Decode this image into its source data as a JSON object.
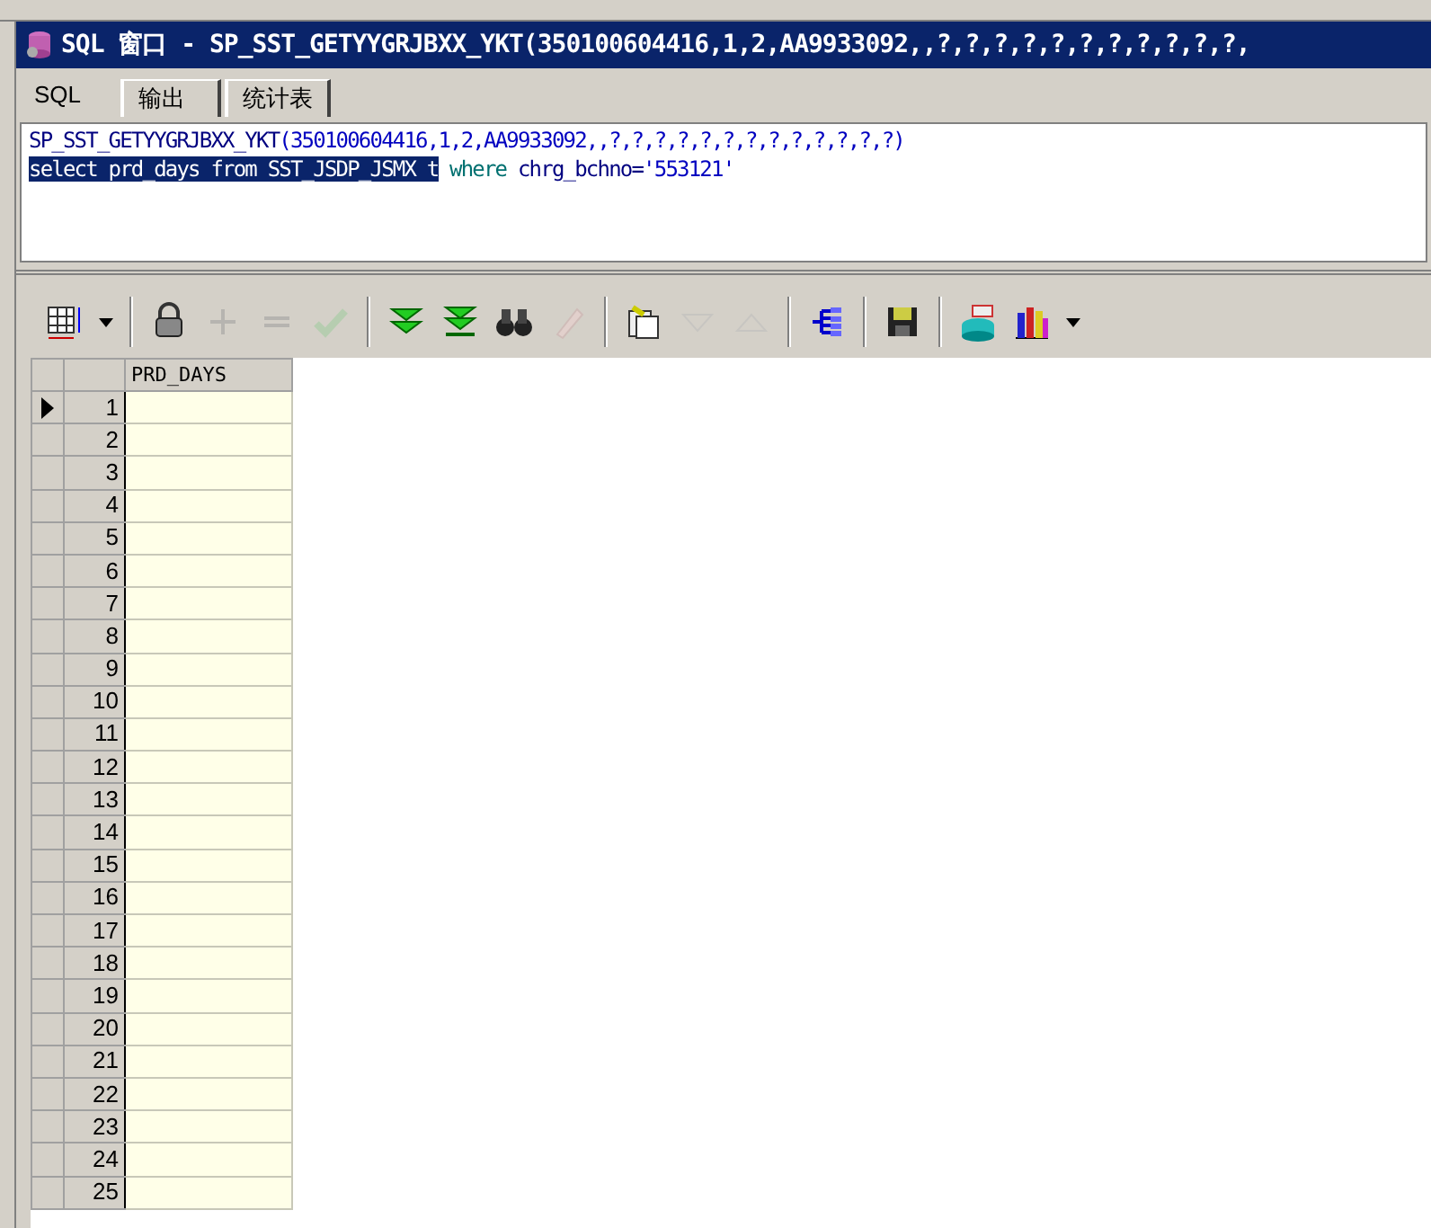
{
  "window": {
    "title": "SQL 窗口 - SP_SST_GETYYGRJBXX_YKT(350100604416,1,2,AA9933092,,?,?,?,?,?,?,?,?,?,?,?,"
  },
  "tabs": [
    {
      "label": "SQL",
      "selected": true
    },
    {
      "label": "输出",
      "selected": false
    },
    {
      "label": "统计表",
      "selected": false
    }
  ],
  "editor": {
    "lines": [
      [
        {
          "text": "SP_SST_GETYYGRJBXX_YKT",
          "kind": "identifier",
          "selected": false
        },
        {
          "text": "(350100604416,1,2,AA9933092,,?,?,?,?,?,?,?,?,?,?,?,?,?)",
          "kind": "literal",
          "selected": false
        }
      ],
      [
        {
          "text": "select prd_days from SST_JSDP_JSMX t",
          "kind": "identifier",
          "selected": true
        },
        {
          "text": " where ",
          "kind": "keyword",
          "selected": false
        },
        {
          "text": "chrg_bchno=",
          "kind": "identifier",
          "selected": false
        },
        {
          "text": "'553121'",
          "kind": "literal",
          "selected": false
        }
      ]
    ]
  },
  "toolbar": [
    {
      "kind": "grid",
      "disabled": false
    },
    {
      "kind": "dropdown",
      "disabled": false
    },
    {
      "kind": "separator"
    },
    {
      "kind": "lock",
      "disabled": false
    },
    {
      "kind": "plus",
      "disabled": true
    },
    {
      "kind": "minus",
      "disabled": true
    },
    {
      "kind": "check",
      "disabled": true
    },
    {
      "kind": "separator"
    },
    {
      "kind": "next",
      "disabled": false
    },
    {
      "kind": "last",
      "disabled": false
    },
    {
      "kind": "binoculars",
      "disabled": false
    },
    {
      "kind": "eraser",
      "disabled": true
    },
    {
      "kind": "separator"
    },
    {
      "kind": "export",
      "disabled": false
    },
    {
      "kind": "down",
      "disabled": true
    },
    {
      "kind": "up",
      "disabled": true
    },
    {
      "kind": "separator"
    },
    {
      "kind": "tree",
      "disabled": false
    },
    {
      "kind": "separator"
    },
    {
      "kind": "save",
      "disabled": false
    },
    {
      "kind": "separator"
    },
    {
      "kind": "printer",
      "disabled": false
    },
    {
      "kind": "chart",
      "disabled": false
    },
    {
      "kind": "dropdown",
      "disabled": false
    }
  ],
  "grid": {
    "columns": [
      "PRD_DAYS"
    ],
    "rows": [
      {
        "number": "1",
        "selected": true
      },
      {
        "number": "2",
        "selected": false
      },
      {
        "number": "3",
        "selected": false
      },
      {
        "number": "4",
        "selected": false
      },
      {
        "number": "5",
        "selected": false
      },
      {
        "number": "6",
        "selected": false
      },
      {
        "number": "7",
        "selected": false
      },
      {
        "number": "8",
        "selected": false
      },
      {
        "number": "9",
        "selected": false
      },
      {
        "number": "10",
        "selected": false
      },
      {
        "number": "11",
        "selected": false
      },
      {
        "number": "12",
        "selected": false
      },
      {
        "number": "13",
        "selected": false
      },
      {
        "number": "14",
        "selected": false
      },
      {
        "number": "15",
        "selected": false
      },
      {
        "number": "16",
        "selected": false
      },
      {
        "number": "17",
        "selected": false
      },
      {
        "number": "18",
        "selected": false
      },
      {
        "number": "19",
        "selected": false
      },
      {
        "number": "20",
        "selected": false
      },
      {
        "number": "21",
        "selected": false
      },
      {
        "number": "22",
        "selected": false
      },
      {
        "number": "23",
        "selected": false
      },
      {
        "number": "24",
        "selected": false
      },
      {
        "number": "25",
        "selected": false
      }
    ]
  }
}
